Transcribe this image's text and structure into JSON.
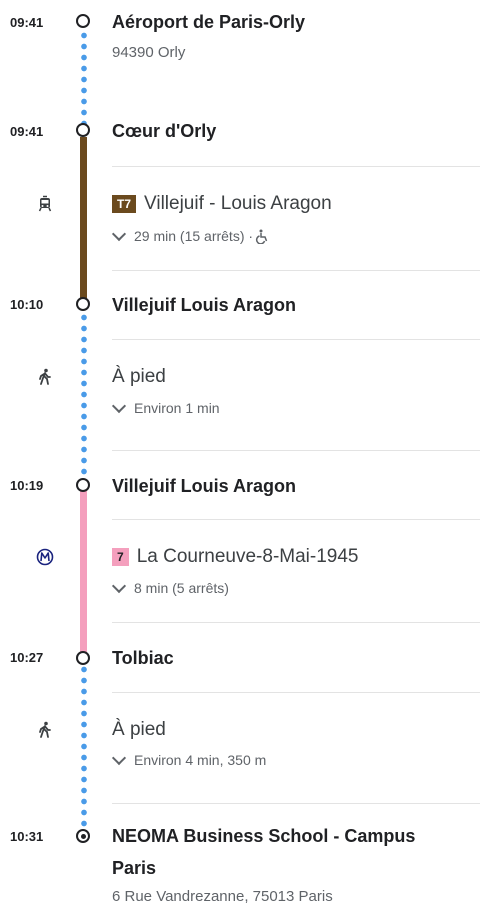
{
  "stops": [
    {
      "time": "09:41",
      "name": "Aéroport de Paris-Orly",
      "address": "94390 Orly"
    },
    {
      "time": "09:41",
      "name": "Cœur d'Orly"
    },
    {
      "time": "10:10",
      "name": "Villejuif Louis Aragon"
    },
    {
      "time": "10:19",
      "name": "Villejuif Louis Aragon"
    },
    {
      "time": "10:27",
      "name": "Tolbiac"
    },
    {
      "time": "10:31",
      "name_line1": "NEOMA Business School - Campus",
      "name_line2": "Paris",
      "address": "6 Rue Vandrezanne, 75013 Paris"
    }
  ],
  "segments": {
    "tram": {
      "badge": "T7",
      "badge_color": "#6b4a1e",
      "direction": "Villejuif - Louis Aragon",
      "detail": "29 min (15 arrêts) · ",
      "icon": "tram-icon",
      "accessible_icon": "wheelchair-icon"
    },
    "walk1": {
      "mode": "À pied",
      "detail": "Environ 1 min",
      "icon": "walking-icon"
    },
    "metro": {
      "badge": "7",
      "badge_color": "#f49fbd",
      "direction": "La Courneuve-8-Mai-1945",
      "detail": "8 min (5 arrêts)",
      "icon": "metro-icon"
    },
    "walk2": {
      "mode": "À pied",
      "detail": "Environ 4 min, 350 m",
      "icon": "walking-icon"
    }
  },
  "colors": {
    "walk_dots": "#4a9be8",
    "tram_line": "#6b4a1e",
    "metro_line": "#f49fbd",
    "metro_icon": "#1a237e"
  }
}
